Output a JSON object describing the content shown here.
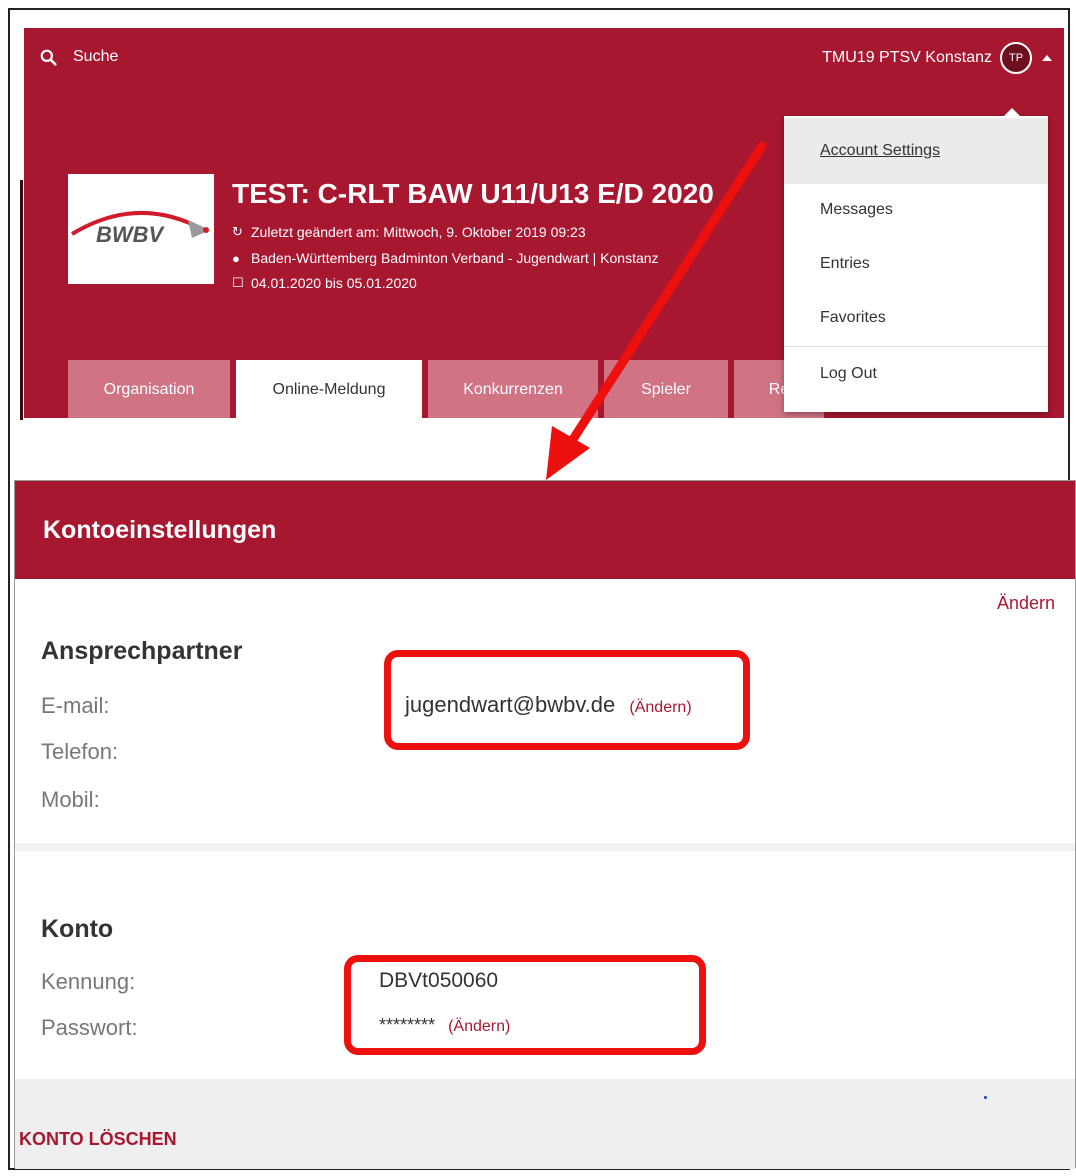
{
  "header": {
    "search_label": "Suche",
    "user_name": "TMU19 PTSV Konstanz",
    "avatar_initials": "TP"
  },
  "tournament": {
    "logo_text": "BWBV",
    "title": "TEST: C-RLT BAW U11/U13 E/D 2020",
    "last_changed": "Zuletzt geändert am: Mittwoch, 9. Oktober 2019 09:23",
    "location": "Baden-Württemberg Badminton Verband - Jugendwart | Konstanz",
    "dates": "04.01.2020 bis 05.01.2020"
  },
  "tabs": [
    {
      "label": "Organisation"
    },
    {
      "label": "Online-Meldung"
    },
    {
      "label": "Konkurrenzen"
    },
    {
      "label": "Spieler"
    },
    {
      "label": "Re"
    }
  ],
  "dropdown": {
    "items": [
      {
        "label": "Account Settings"
      },
      {
        "label": "Messages"
      },
      {
        "label": "Entries"
      },
      {
        "label": "Favorites"
      },
      {
        "label": "Log Out"
      }
    ]
  },
  "account": {
    "heading": "Kontoeinstellungen",
    "edit_label": "Ändern",
    "contact": {
      "title": "Ansprechpartner",
      "email_label": "E-mail:",
      "email_value": "jugendwart@bwbv.de",
      "email_edit": "(Ändern)",
      "phone_label": "Telefon:",
      "mobile_label": "Mobil:"
    },
    "konto": {
      "title": "Konto",
      "id_label": "Kennung:",
      "id_value": "DBVt050060",
      "password_label": "Passwort:",
      "password_value": "********",
      "password_edit": "(Ändern)"
    },
    "delete_label": "KONTO LÖSCHEN"
  },
  "colors": {
    "brand": "#a81730",
    "tab_inactive": "#d07384",
    "annotation": "#ee0f0f"
  }
}
